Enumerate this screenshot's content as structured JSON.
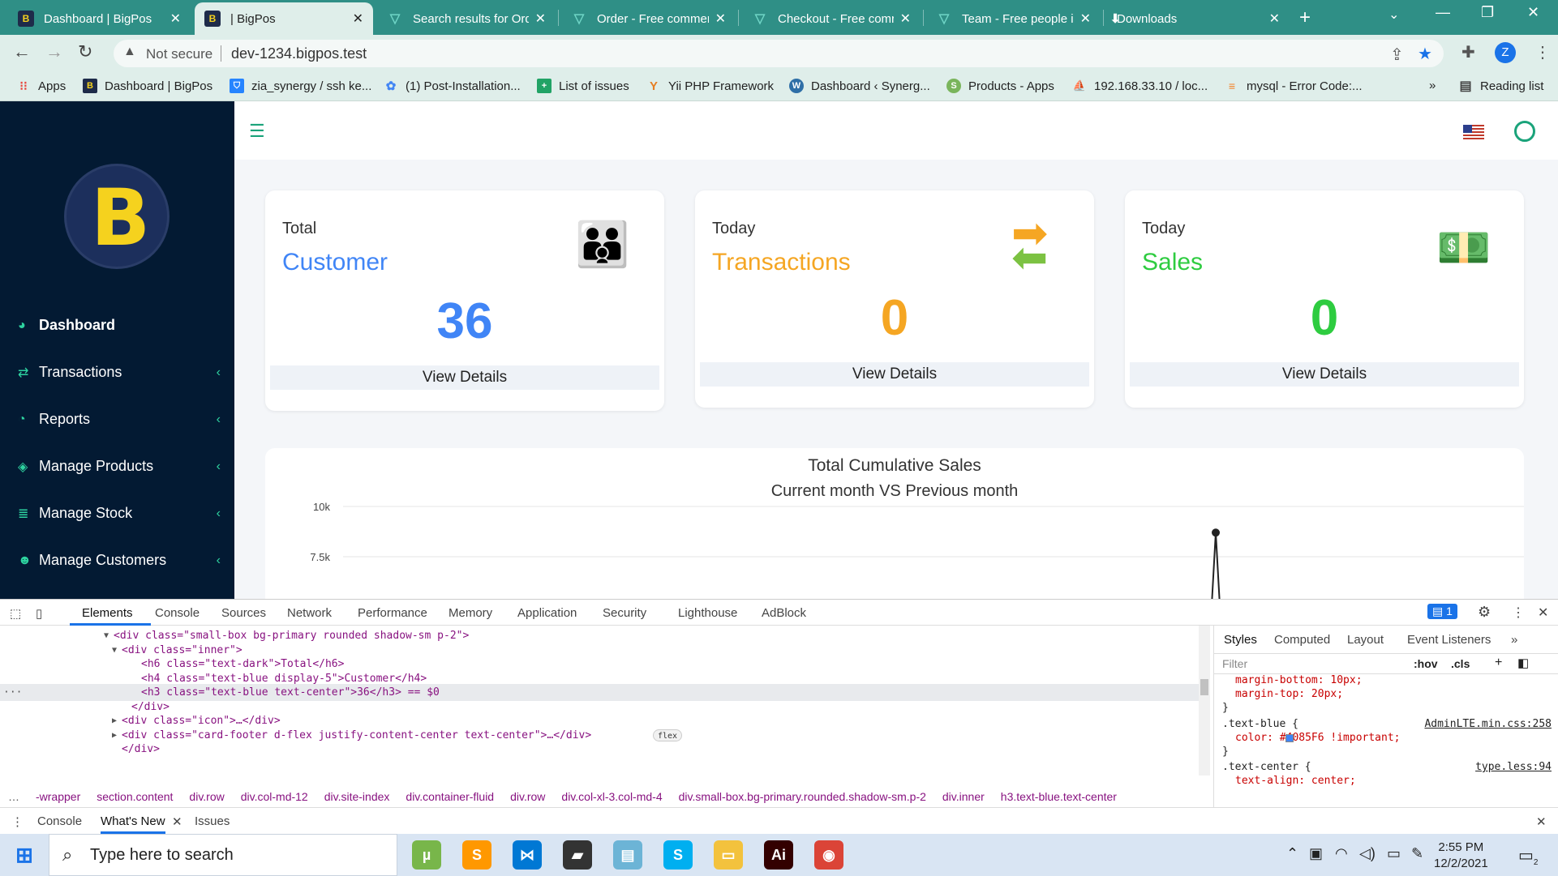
{
  "browser": {
    "tabs": [
      {
        "label": "Dashboard | BigPos",
        "favicon": "bigpos-logo-icon",
        "active": false
      },
      {
        "label": "| BigPos",
        "favicon": "bigpos-logo-icon",
        "active": true
      },
      {
        "label": "Search results for Ord",
        "favicon": "triangle-logo-icon",
        "active": false
      },
      {
        "label": "Order - Free commer",
        "favicon": "triangle-logo-icon",
        "active": false
      },
      {
        "label": "Checkout - Free comr",
        "favicon": "triangle-logo-icon",
        "active": false
      },
      {
        "label": "Team - Free people ic",
        "favicon": "triangle-logo-icon",
        "active": false
      },
      {
        "label": "Downloads",
        "favicon": "download-icon",
        "active": false
      }
    ],
    "address": {
      "security": "Not secure",
      "url": "dev-1234.bigpos.test"
    },
    "profile_initial": "Z",
    "bookmarks": [
      {
        "label": "Apps",
        "icon": "apps-grid-icon",
        "color": "#e8453c"
      },
      {
        "label": "Dashboard | BigPos",
        "icon": "bigpos-logo-icon",
        "color": "#1e2b4a"
      },
      {
        "label": "zia_synergy / ssh ke...",
        "icon": "bitbucket-icon",
        "color": "#2684ff"
      },
      {
        "label": "(1) Post-Installation...",
        "icon": "cluster-icon",
        "color": "#4285f4"
      },
      {
        "label": "List of issues",
        "icon": "plus-box-icon",
        "color": "#21a366"
      },
      {
        "label": "Yii PHP Framework",
        "icon": "yii-icon",
        "color": "#e67e22"
      },
      {
        "label": "Dashboard ‹ Synerg...",
        "icon": "wordpress-icon",
        "color": "#2f6fa7"
      },
      {
        "label": "Products - Apps",
        "icon": "shopify-icon",
        "color": "#7ab55c"
      },
      {
        "label": "192.168.33.10 / loc...",
        "icon": "phpmyadmin-icon",
        "color": "#f39c12"
      },
      {
        "label": "mysql - Error Code:...",
        "icon": "stackoverflow-icon",
        "color": "#f48024"
      }
    ],
    "reading_list": "Reading list"
  },
  "sidebar": {
    "items": [
      {
        "label": "Dashboard",
        "icon": "palette-icon",
        "active": true,
        "has_chevron": false
      },
      {
        "label": "Transactions",
        "icon": "exchange-icon",
        "active": false,
        "has_chevron": true
      },
      {
        "label": "Reports",
        "icon": "pie-chart-icon",
        "active": false,
        "has_chevron": true
      },
      {
        "label": "Manage Products",
        "icon": "cubes-icon",
        "active": false,
        "has_chevron": true
      },
      {
        "label": "Manage Stock",
        "icon": "database-icon",
        "active": false,
        "has_chevron": true
      },
      {
        "label": "Manage Customers",
        "icon": "users-icon",
        "active": false,
        "has_chevron": true
      }
    ]
  },
  "cards": [
    {
      "small": "Total",
      "title": "Customer",
      "value": "36",
      "footer": "View Details",
      "color": "#4085F6",
      "icon": "customers-icon"
    },
    {
      "small": "Today",
      "title": "Transactions",
      "value": "0",
      "footer": "View Details",
      "color": "#f5a623",
      "icon": "arrows-exchange-icon"
    },
    {
      "small": "Today",
      "title": "Sales",
      "value": "0",
      "footer": "View Details",
      "color": "#2ecc40",
      "icon": "money-stack-icon"
    }
  ],
  "chart": {
    "title": "Total Cumulative Sales",
    "subtitle": "Current month VS Previous month"
  },
  "chart_data": {
    "type": "line",
    "title": "Total Cumulative Sales",
    "subtitle": "Current month VS Previous month",
    "y_ticks": [
      "10k",
      "7.5k"
    ],
    "series": [
      {
        "values": [
          0,
          8700,
          0
        ]
      }
    ],
    "ylim": [
      0,
      10000
    ],
    "grid": true
  },
  "devtools": {
    "tabs": [
      "Elements",
      "Console",
      "Sources",
      "Network",
      "Performance",
      "Memory",
      "Application",
      "Security",
      "Lighthouse",
      "AdBlock"
    ],
    "issues_count": "1",
    "dom_lines": [
      {
        "indent": 140,
        "arrow": "▼",
        "html": "<div class=\"small-box bg-primary rounded shadow-sm p-2\">",
        "selected": false
      },
      {
        "indent": 150,
        "arrow": "▼",
        "html": "<div class=\"inner\">",
        "selected": false
      },
      {
        "indent": 174,
        "arrow": "",
        "html": "<h6 class=\"text-dark\">Total</h6>",
        "selected": false
      },
      {
        "indent": 174,
        "arrow": "",
        "html": "<h4 class=\"text-blue display-5\">Customer</h4>",
        "selected": false
      },
      {
        "indent": 174,
        "arrow": "",
        "html": "<h3 class=\"text-blue text-center\">36</h3> == $0",
        "selected": true
      },
      {
        "indent": 162,
        "arrow": "",
        "html": "</div>",
        "selected": false
      },
      {
        "indent": 150,
        "arrow": "▶",
        "html": "<div class=\"icon\">…</div>",
        "selected": false
      },
      {
        "indent": 150,
        "arrow": "▶",
        "html": "<div class=\"card-footer d-flex justify-content-center text-center\">…</div>",
        "badge": "flex",
        "selected": false
      },
      {
        "indent": 150,
        "arrow": "",
        "html": "</div>",
        "selected": false
      }
    ],
    "breadcrumbs": [
      "-wrapper",
      "section.content",
      "div.row",
      "div.col-md-12",
      "div.site-index",
      "div.container-fluid",
      "div.row",
      "div.col-xl-3.col-md-4",
      "div.small-box.bg-primary.rounded.shadow-sm.p-2",
      "div.inner",
      "h3.text-blue.text-center"
    ],
    "styles_tabs": [
      "Styles",
      "Computed",
      "Layout",
      "Event Listeners"
    ],
    "filter_placeholder": "Filter",
    "filter_buttons": [
      ":hov",
      ".cls"
    ],
    "style_lines": [
      {
        "text": "margin-bottom: 10px;",
        "top": 60
      },
      {
        "text": "margin-top: 20px;",
        "top": 77
      },
      {
        "text": "}",
        "top": 94
      },
      {
        "text": ".text-blue {",
        "top": 114,
        "source": "AdminLTE.min.css:258"
      },
      {
        "text": "color: #4085F6 !important;",
        "top": 131
      },
      {
        "text": "}",
        "top": 148
      },
      {
        "text": ".text-center {",
        "top": 167,
        "source": "type.less:94"
      },
      {
        "text": "text-align: center;",
        "top": 184
      }
    ],
    "drawer_tabs": [
      "Console",
      "What's New",
      "Issues"
    ]
  },
  "taskbar": {
    "search_placeholder": "Type here to search",
    "apps": [
      {
        "name": "utorrent-icon",
        "glyph": "µ",
        "color": "#78b64a"
      },
      {
        "name": "sublime-icon",
        "glyph": "S",
        "color": "#ff9800"
      },
      {
        "name": "vscode-icon",
        "glyph": "⋈",
        "color": "#0078d4"
      },
      {
        "name": "sticky-notes-icon",
        "glyph": "▰",
        "color": "#333"
      },
      {
        "name": "file-app-icon",
        "glyph": "▤",
        "color": "#6cb4d6"
      },
      {
        "name": "skype-icon",
        "glyph": "S",
        "color": "#00aff0"
      },
      {
        "name": "file-explorer-icon",
        "glyph": "▭",
        "color": "#f3c23d"
      },
      {
        "name": "illustrator-icon",
        "glyph": "Ai",
        "color": "#330000"
      },
      {
        "name": "chrome-icon",
        "glyph": "◉",
        "color": "#db4437"
      }
    ],
    "time": "2:55 PM",
    "date": "12/2/2021",
    "notification_count": "2"
  }
}
